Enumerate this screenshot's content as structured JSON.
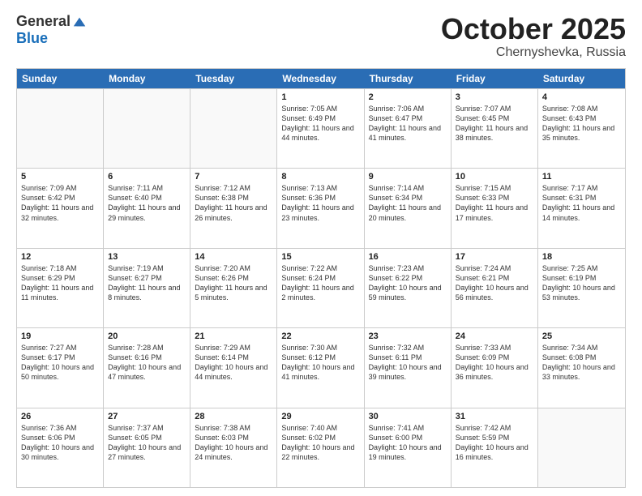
{
  "header": {
    "logo_general": "General",
    "logo_blue": "Blue",
    "month_title": "October 2025",
    "location": "Chernyshevka, Russia"
  },
  "days_of_week": [
    "Sunday",
    "Monday",
    "Tuesday",
    "Wednesday",
    "Thursday",
    "Friday",
    "Saturday"
  ],
  "weeks": [
    [
      {
        "day": "",
        "empty": true
      },
      {
        "day": "",
        "empty": true
      },
      {
        "day": "",
        "empty": true
      },
      {
        "day": "1",
        "sunrise": "7:05 AM",
        "sunset": "6:49 PM",
        "daylight": "11 hours and 44 minutes."
      },
      {
        "day": "2",
        "sunrise": "7:06 AM",
        "sunset": "6:47 PM",
        "daylight": "11 hours and 41 minutes."
      },
      {
        "day": "3",
        "sunrise": "7:07 AM",
        "sunset": "6:45 PM",
        "daylight": "11 hours and 38 minutes."
      },
      {
        "day": "4",
        "sunrise": "7:08 AM",
        "sunset": "6:43 PM",
        "daylight": "11 hours and 35 minutes."
      }
    ],
    [
      {
        "day": "5",
        "sunrise": "7:09 AM",
        "sunset": "6:42 PM",
        "daylight": "11 hours and 32 minutes."
      },
      {
        "day": "6",
        "sunrise": "7:11 AM",
        "sunset": "6:40 PM",
        "daylight": "11 hours and 29 minutes."
      },
      {
        "day": "7",
        "sunrise": "7:12 AM",
        "sunset": "6:38 PM",
        "daylight": "11 hours and 26 minutes."
      },
      {
        "day": "8",
        "sunrise": "7:13 AM",
        "sunset": "6:36 PM",
        "daylight": "11 hours and 23 minutes."
      },
      {
        "day": "9",
        "sunrise": "7:14 AM",
        "sunset": "6:34 PM",
        "daylight": "11 hours and 20 minutes."
      },
      {
        "day": "10",
        "sunrise": "7:15 AM",
        "sunset": "6:33 PM",
        "daylight": "11 hours and 17 minutes."
      },
      {
        "day": "11",
        "sunrise": "7:17 AM",
        "sunset": "6:31 PM",
        "daylight": "11 hours and 14 minutes."
      }
    ],
    [
      {
        "day": "12",
        "sunrise": "7:18 AM",
        "sunset": "6:29 PM",
        "daylight": "11 hours and 11 minutes."
      },
      {
        "day": "13",
        "sunrise": "7:19 AM",
        "sunset": "6:27 PM",
        "daylight": "11 hours and 8 minutes."
      },
      {
        "day": "14",
        "sunrise": "7:20 AM",
        "sunset": "6:26 PM",
        "daylight": "11 hours and 5 minutes."
      },
      {
        "day": "15",
        "sunrise": "7:22 AM",
        "sunset": "6:24 PM",
        "daylight": "11 hours and 2 minutes."
      },
      {
        "day": "16",
        "sunrise": "7:23 AM",
        "sunset": "6:22 PM",
        "daylight": "10 hours and 59 minutes."
      },
      {
        "day": "17",
        "sunrise": "7:24 AM",
        "sunset": "6:21 PM",
        "daylight": "10 hours and 56 minutes."
      },
      {
        "day": "18",
        "sunrise": "7:25 AM",
        "sunset": "6:19 PM",
        "daylight": "10 hours and 53 minutes."
      }
    ],
    [
      {
        "day": "19",
        "sunrise": "7:27 AM",
        "sunset": "6:17 PM",
        "daylight": "10 hours and 50 minutes."
      },
      {
        "day": "20",
        "sunrise": "7:28 AM",
        "sunset": "6:16 PM",
        "daylight": "10 hours and 47 minutes."
      },
      {
        "day": "21",
        "sunrise": "7:29 AM",
        "sunset": "6:14 PM",
        "daylight": "10 hours and 44 minutes."
      },
      {
        "day": "22",
        "sunrise": "7:30 AM",
        "sunset": "6:12 PM",
        "daylight": "10 hours and 41 minutes."
      },
      {
        "day": "23",
        "sunrise": "7:32 AM",
        "sunset": "6:11 PM",
        "daylight": "10 hours and 39 minutes."
      },
      {
        "day": "24",
        "sunrise": "7:33 AM",
        "sunset": "6:09 PM",
        "daylight": "10 hours and 36 minutes."
      },
      {
        "day": "25",
        "sunrise": "7:34 AM",
        "sunset": "6:08 PM",
        "daylight": "10 hours and 33 minutes."
      }
    ],
    [
      {
        "day": "26",
        "sunrise": "7:36 AM",
        "sunset": "6:06 PM",
        "daylight": "10 hours and 30 minutes."
      },
      {
        "day": "27",
        "sunrise": "7:37 AM",
        "sunset": "6:05 PM",
        "daylight": "10 hours and 27 minutes."
      },
      {
        "day": "28",
        "sunrise": "7:38 AM",
        "sunset": "6:03 PM",
        "daylight": "10 hours and 24 minutes."
      },
      {
        "day": "29",
        "sunrise": "7:40 AM",
        "sunset": "6:02 PM",
        "daylight": "10 hours and 22 minutes."
      },
      {
        "day": "30",
        "sunrise": "7:41 AM",
        "sunset": "6:00 PM",
        "daylight": "10 hours and 19 minutes."
      },
      {
        "day": "31",
        "sunrise": "7:42 AM",
        "sunset": "5:59 PM",
        "daylight": "10 hours and 16 minutes."
      },
      {
        "day": "",
        "empty": true
      }
    ]
  ]
}
